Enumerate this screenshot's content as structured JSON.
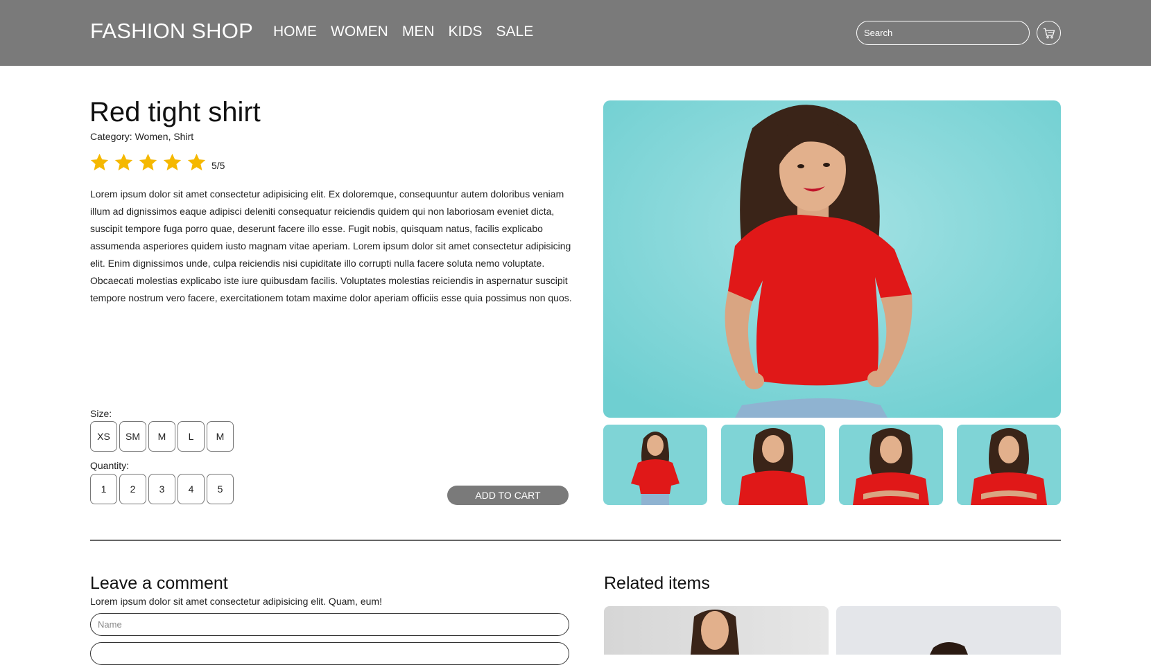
{
  "header": {
    "logo": "FASHION SHOP",
    "nav": [
      "HOME",
      "WOMEN",
      "MEN",
      "KIDS",
      "SALE"
    ],
    "search_placeholder": "Search",
    "cart_icon": "shopping-cart-icon"
  },
  "product": {
    "title": "Red tight shirt",
    "category": "Category: Women, Shirt",
    "rating": {
      "stars": 5,
      "max": 5,
      "text": "5/5"
    },
    "description": "Lorem ipsum dolor sit amet consectetur adipisicing elit. Ex doloremque, consequuntur autem doloribus veniam illum ad dignissimos eaque adipisci deleniti consequatur reiciendis quidem qui non laboriosam eveniet dicta, suscipit tempore fuga porro quae, deserunt facere illo esse. Fugit nobis, quisquam natus, facilis explicabo assumenda asperiores quidem iusto magnam vitae aperiam. Lorem ipsum dolor sit amet consectetur adipisicing elit. Enim dignissimos unde, culpa reiciendis nisi cupiditate illo corrupti nulla facere soluta nemo voluptate. Obcaecati molestias explicabo iste iure quibusdam facilis. Voluptates molestias reiciendis in aspernatur suscipit tempore nostrum vero facere, exercitationem totam maxime dolor aperiam officiis esse quia possimus non quos.",
    "size_label": "Size:",
    "sizes": [
      "XS",
      "SM",
      "M",
      "L",
      "M"
    ],
    "quantity_label": "Quantity:",
    "quantities": [
      "1",
      "2",
      "3",
      "4",
      "5"
    ],
    "add_to_cart": "ADD TO CART"
  },
  "comment": {
    "title": "Leave a comment",
    "subtitle": "Lorem ipsum dolor sit amet consectetur adipisicing elit. Quam, eum!",
    "name_placeholder": "Name"
  },
  "related": {
    "title": "Related items"
  },
  "colors": {
    "header_bg": "#7a7a7a",
    "star": "#f5b800",
    "image_bg": "#7fd4d6",
    "shirt": "#e01818"
  }
}
